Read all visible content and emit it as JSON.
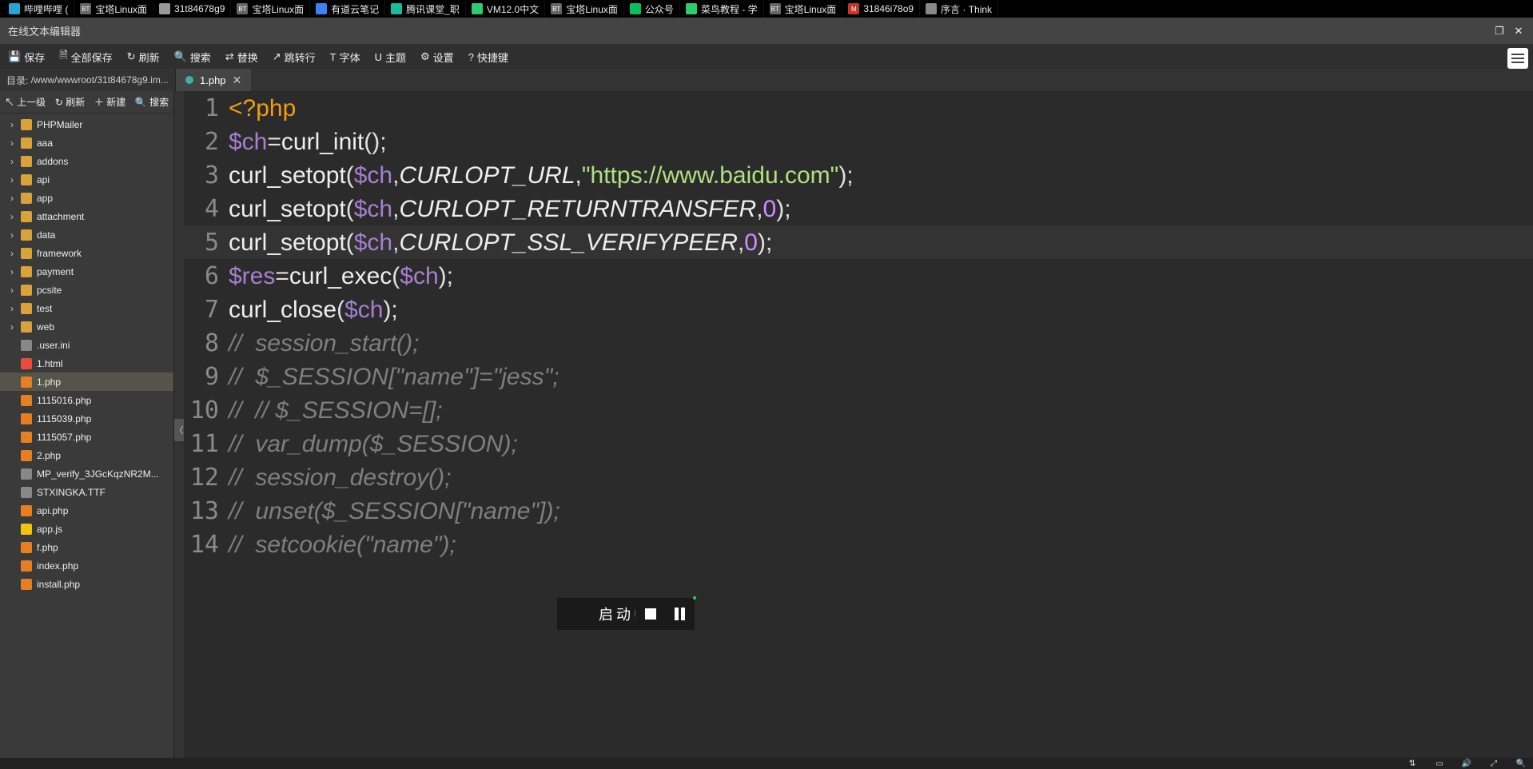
{
  "browser_tabs": [
    {
      "label": "哔哩哔哩 (",
      "icon_color": "#2ba3d4"
    },
    {
      "label": "宝塔Linux面",
      "icon_color": "#666",
      "prefix": "BT"
    },
    {
      "label": "31t84678g9",
      "icon_color": "#999"
    },
    {
      "label": "宝塔Linux面",
      "icon_color": "#666",
      "prefix": "BT"
    },
    {
      "label": "有道云笔记",
      "icon_color": "#3b82f6"
    },
    {
      "label": "腾讯课堂_职",
      "icon_color": "#1abc9c"
    },
    {
      "label": "VM12.0中文",
      "icon_color": "#2ecc71"
    },
    {
      "label": "宝塔Linux面",
      "icon_color": "#666",
      "prefix": "BT"
    },
    {
      "label": "公众号",
      "icon_color": "#07c160"
    },
    {
      "label": "菜鸟教程 - 学",
      "icon_color": "#2ecc71"
    },
    {
      "label": "宝塔Linux面",
      "icon_color": "#666",
      "prefix": "BT"
    },
    {
      "label": "31846i78o9",
      "icon_color": "#c0392b",
      "prefix": "M"
    },
    {
      "label": "序言 · Think",
      "icon_color": "#888"
    }
  ],
  "title": "在线文本编辑器",
  "toolbar": {
    "save": "保存",
    "save_all": "全部保存",
    "refresh": "刷新",
    "search": "搜索",
    "replace": "替换",
    "goto": "跳转行",
    "font": "字体",
    "theme": "主题",
    "settings": "设置",
    "shortcut": "快捷键"
  },
  "path_label": "目录:",
  "path_value": "/www/wwwroot/31t84678g9.im...",
  "open_tab": {
    "name": "1.php"
  },
  "sidebar_actions": {
    "up": "上一级",
    "refresh": "刷新",
    "new": "新建",
    "search": "搜索"
  },
  "tree": [
    {
      "type": "folder",
      "name": "PHPMailer"
    },
    {
      "type": "folder",
      "name": "aaa"
    },
    {
      "type": "folder",
      "name": "addons"
    },
    {
      "type": "folder",
      "name": "api"
    },
    {
      "type": "folder",
      "name": "app"
    },
    {
      "type": "folder",
      "name": "attachment"
    },
    {
      "type": "folder",
      "name": "data"
    },
    {
      "type": "folder",
      "name": "framework"
    },
    {
      "type": "folder",
      "name": "payment"
    },
    {
      "type": "folder",
      "name": "pcsite"
    },
    {
      "type": "folder",
      "name": "test"
    },
    {
      "type": "folder",
      "name": "web"
    },
    {
      "type": "txt",
      "name": ".user.ini"
    },
    {
      "type": "html",
      "name": "1.html"
    },
    {
      "type": "php",
      "name": "1.php",
      "selected": true
    },
    {
      "type": "php",
      "name": "1115016.php"
    },
    {
      "type": "php",
      "name": "1115039.php"
    },
    {
      "type": "php",
      "name": "1115057.php"
    },
    {
      "type": "php",
      "name": "2.php"
    },
    {
      "type": "txt",
      "name": "MP_verify_3JGcKqzNR2M..."
    },
    {
      "type": "txt",
      "name": "STXINGKA.TTF"
    },
    {
      "type": "php",
      "name": "api.php"
    },
    {
      "type": "js",
      "name": "app.js"
    },
    {
      "type": "php",
      "name": "f.php"
    },
    {
      "type": "php",
      "name": "index.php"
    },
    {
      "type": "php",
      "name": "install.php"
    }
  ],
  "code": [
    {
      "n": 1,
      "tokens": [
        {
          "c": "tag",
          "t": "<?php"
        }
      ]
    },
    {
      "n": 2,
      "tokens": [
        {
          "c": "var",
          "t": "$ch"
        },
        {
          "c": "op",
          "t": "="
        },
        {
          "c": "fn",
          "t": "curl_init"
        },
        {
          "c": "punct",
          "t": "();"
        }
      ]
    },
    {
      "n": 3,
      "tokens": [
        {
          "c": "fn",
          "t": "curl_setopt"
        },
        {
          "c": "punct",
          "t": "("
        },
        {
          "c": "var",
          "t": "$ch"
        },
        {
          "c": "punct",
          "t": ","
        },
        {
          "c": "const",
          "t": "CURLOPT_URL"
        },
        {
          "c": "punct",
          "t": ","
        },
        {
          "c": "str",
          "t": "\"https://www.baidu.com\""
        },
        {
          "c": "punct",
          "t": ");"
        }
      ]
    },
    {
      "n": 4,
      "tokens": [
        {
          "c": "fn",
          "t": "curl_setopt"
        },
        {
          "c": "punct",
          "t": "("
        },
        {
          "c": "var",
          "t": "$ch"
        },
        {
          "c": "punct",
          "t": ","
        },
        {
          "c": "const",
          "t": "CURLOPT_RETURNTRANSFER"
        },
        {
          "c": "punct",
          "t": ","
        },
        {
          "c": "num",
          "t": "0"
        },
        {
          "c": "punct",
          "t": ");"
        }
      ]
    },
    {
      "n": 5,
      "hl": true,
      "tokens": [
        {
          "c": "fn",
          "t": "curl_setopt"
        },
        {
          "c": "punct",
          "t": "("
        },
        {
          "c": "var",
          "t": "$ch"
        },
        {
          "c": "punct",
          "t": ","
        },
        {
          "c": "const",
          "t": "CURLOPT_SSL_VERIFYPEER"
        },
        {
          "c": "punct",
          "t": ","
        },
        {
          "c": "num",
          "t": "0"
        },
        {
          "c": "punct",
          "t": ");"
        }
      ]
    },
    {
      "n": 6,
      "tokens": [
        {
          "c": "var",
          "t": "$res"
        },
        {
          "c": "op",
          "t": "="
        },
        {
          "c": "fn",
          "t": "curl_exec"
        },
        {
          "c": "punct",
          "t": "("
        },
        {
          "c": "var",
          "t": "$ch"
        },
        {
          "c": "punct",
          "t": ");"
        }
      ]
    },
    {
      "n": 7,
      "tokens": [
        {
          "c": "fn",
          "t": "curl_close"
        },
        {
          "c": "punct",
          "t": "("
        },
        {
          "c": "var",
          "t": "$ch"
        },
        {
          "c": "punct",
          "t": ");"
        }
      ]
    },
    {
      "n": 8,
      "tokens": [
        {
          "c": "com",
          "t": "//  session_start();"
        }
      ]
    },
    {
      "n": 9,
      "tokens": [
        {
          "c": "com",
          "t": "//  $_SESSION[\"name\"]=\"jess\";"
        }
      ]
    },
    {
      "n": 10,
      "tokens": [
        {
          "c": "com",
          "t": "//  // $_SESSION=[];"
        }
      ]
    },
    {
      "n": 11,
      "tokens": [
        {
          "c": "com",
          "t": "//  var_dump($_SESSION);"
        }
      ]
    },
    {
      "n": 12,
      "tokens": [
        {
          "c": "com",
          "t": "//  session_destroy();"
        }
      ]
    },
    {
      "n": 13,
      "tokens": [
        {
          "c": "com",
          "t": "//  unset($_SESSION[\"name\"]);"
        }
      ]
    },
    {
      "n": 14,
      "tokens": [
        {
          "c": "com",
          "t": "//  setcookie(\"name\");"
        }
      ]
    }
  ],
  "player_label": "启动中"
}
